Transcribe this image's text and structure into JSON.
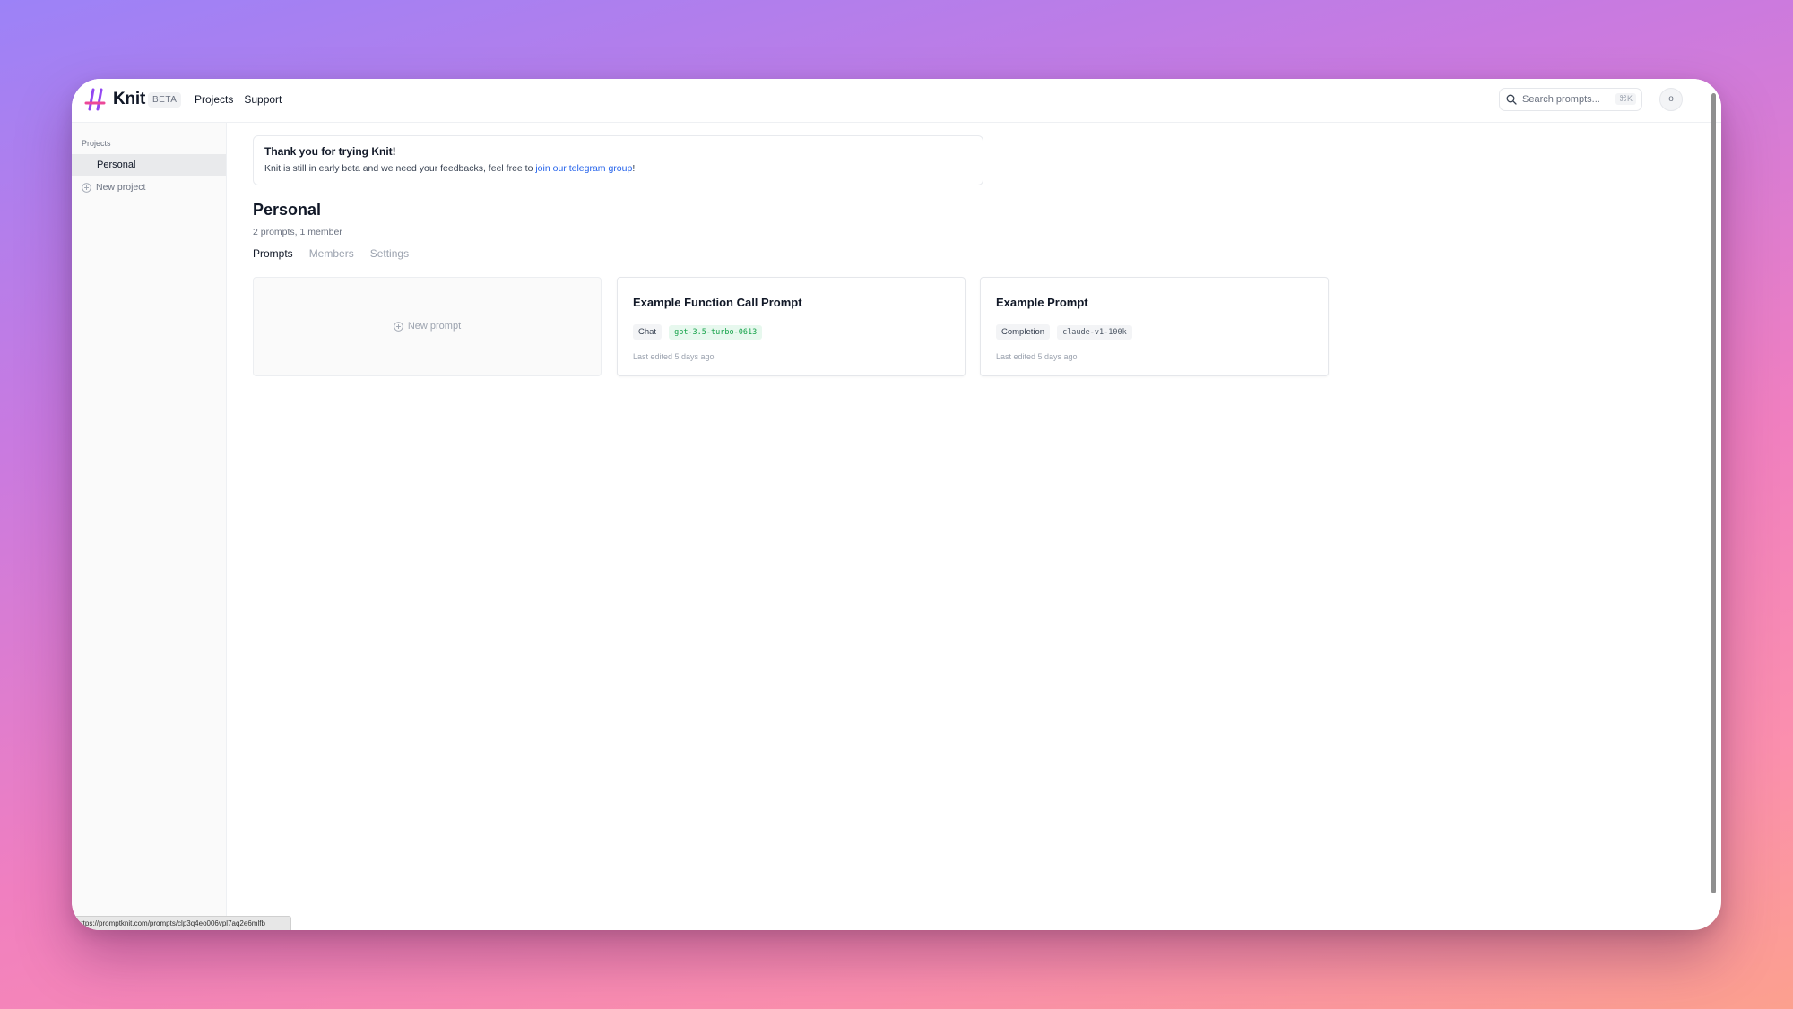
{
  "header": {
    "brand": "Knit",
    "badge": "BETA",
    "nav": [
      "Projects",
      "Support"
    ],
    "search_placeholder": "Search prompts...",
    "search_shortcut": "⌘K",
    "avatar_initial": "o"
  },
  "sidebar": {
    "heading": "Projects",
    "items": [
      {
        "label": "Personal",
        "active": true
      }
    ],
    "new_project": "New project"
  },
  "banner": {
    "title": "Thank you for trying Knit!",
    "text_before": "Knit is still in early beta and we need your feedbacks, feel free to ",
    "link": "join our telegram group",
    "text_after": "!"
  },
  "project": {
    "title": "Personal",
    "summary": "2 prompts, 1 member",
    "tabs": [
      {
        "label": "Prompts",
        "active": true
      },
      {
        "label": "Members",
        "active": false
      },
      {
        "label": "Settings",
        "active": false
      }
    ]
  },
  "new_prompt_label": "New prompt",
  "prompts": [
    {
      "title": "Example Function Call Prompt",
      "type": "Chat",
      "model": "gpt-3.5-turbo-0613",
      "meta": "Last edited 5 days ago"
    },
    {
      "title": "Example Prompt",
      "type": "Completion",
      "model": "claude-v1-100k",
      "meta": "Last edited 5 days ago"
    }
  ],
  "status_url": "https://promptknit.com/prompts/clp3q4eo006vpl7aq2e6mlfb",
  "colors": {
    "accent_link": "#2563eb",
    "model_tag_green": "#16a34a"
  }
}
